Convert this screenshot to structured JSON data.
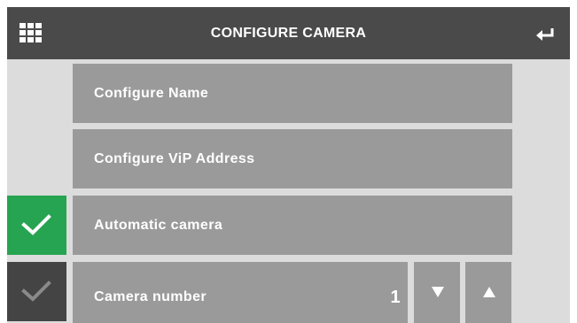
{
  "header": {
    "title": "CONFIGURE CAMERA",
    "menu_icon": "grid-menu-icon",
    "back_icon": "return-arrow-icon"
  },
  "menu": {
    "configure_name": "Configure Name",
    "configure_vip": "Configure ViP Address",
    "automatic_camera": "Automatic camera",
    "automatic_camera_checked": true,
    "camera_number_label": "Camera number",
    "camera_number_value": "1"
  },
  "stepper": {
    "down_icon": "triangle-down-icon",
    "up_icon": "triangle-up-icon"
  },
  "colors": {
    "header_bg": "#4a4a4a",
    "item_bg": "#9a9a9a",
    "panel_bg": "#dcdcdc",
    "check_active": "#27a451",
    "check_inactive": "#444444"
  }
}
